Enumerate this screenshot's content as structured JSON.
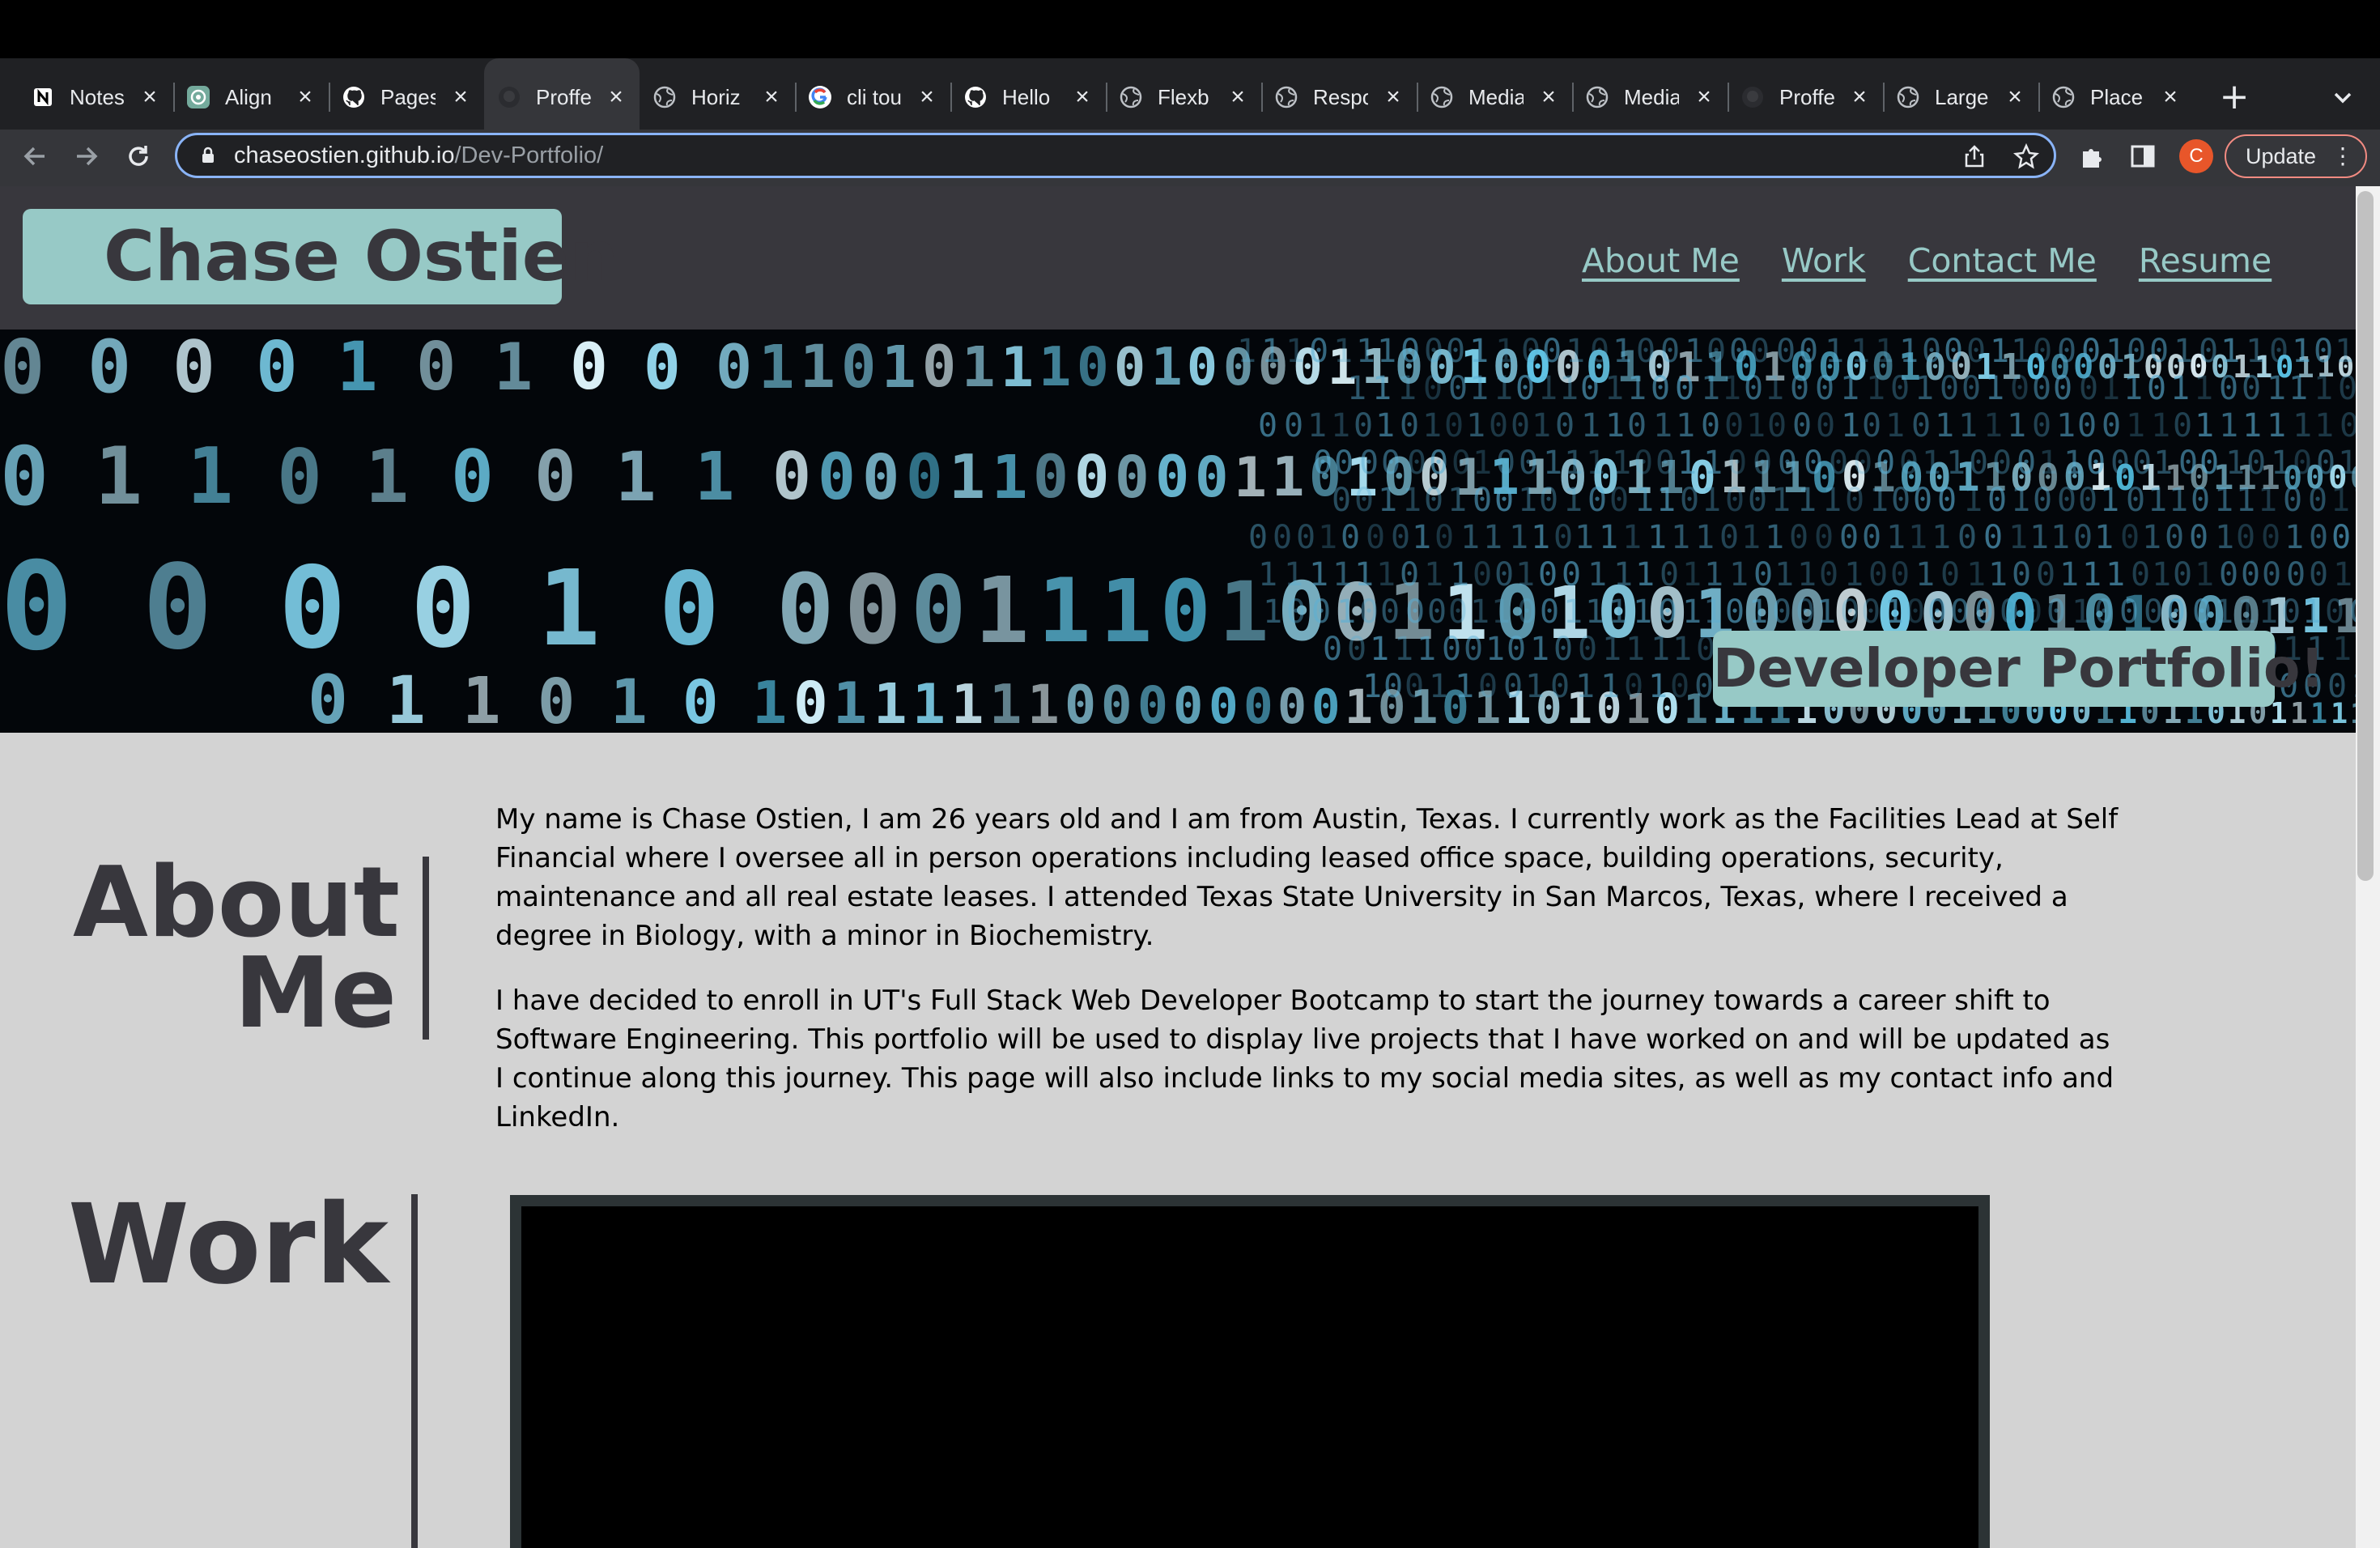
{
  "browser": {
    "tabs": [
      {
        "title": "Notes",
        "icon": "notion-icon"
      },
      {
        "title": "Align",
        "icon": "chatgpt-icon"
      },
      {
        "title": "Pages",
        "icon": "github-icon"
      },
      {
        "title": "Proffe",
        "icon": "github-icon",
        "active": true
      },
      {
        "title": "Horiz",
        "icon": "globe-icon"
      },
      {
        "title": "cli tou",
        "icon": "google-icon"
      },
      {
        "title": "Hello",
        "icon": "github-icon"
      },
      {
        "title": "Flexb",
        "icon": "globe-icon"
      },
      {
        "title": "Respo",
        "icon": "globe-icon"
      },
      {
        "title": "Media",
        "icon": "globe-icon"
      },
      {
        "title": "Media",
        "icon": "globe-icon"
      },
      {
        "title": "Proffe",
        "icon": "github-icon"
      },
      {
        "title": "Large",
        "icon": "globe-icon"
      },
      {
        "title": "Place",
        "icon": "globe-icon"
      }
    ],
    "url_host": "chaseostien.github.io",
    "url_path": "/Dev-Portfolio/",
    "profile_initial": "C",
    "update_label": "Update"
  },
  "site": {
    "logo": "Chase Ostien",
    "nav": [
      "About Me",
      "Work",
      "Contact Me",
      "Resume"
    ],
    "hero_badge": "Developer Portfolio!",
    "about": {
      "title_line1": "About",
      "title_line2": "Me",
      "paragraphs": [
        "My name is Chase Ostien, I am 26 years old and I am from Austin, Texas. I currently work as the Facilities Lead at Self Financial where I oversee all in person operations including leased office space, building operations, security, maintenance and all real estate leases. I attended Texas State University in San Marcos, Texas, where I received a degree in Biology, with a minor in Biochemistry.",
        "I have decided to enroll in UT's Full Stack Web Developer Bootcamp to start the journey towards a career shift to Software Engineering. This portfolio will be used to display live projects that I have worked on and will be updated as I continue along this journey. This page will also include links to my social media sites, as well as my contact info and LinkedIn."
      ]
    },
    "work": {
      "title": "Work"
    }
  },
  "colors": {
    "accent": "#97c9c6",
    "header_bg": "#38373d",
    "page_bg": "#d3d3d3"
  }
}
